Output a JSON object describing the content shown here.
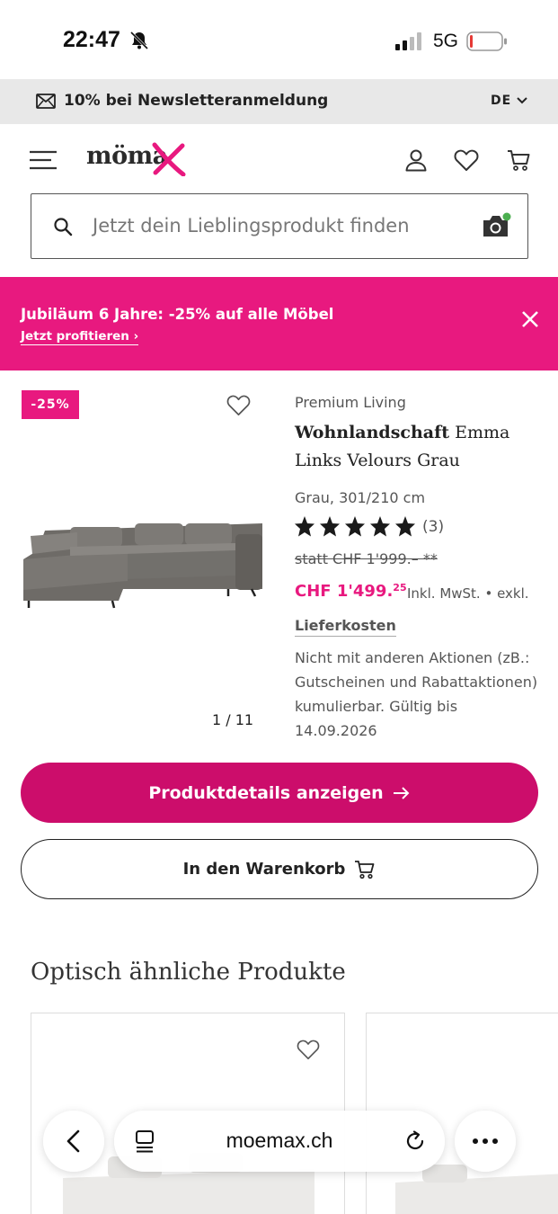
{
  "status_bar": {
    "time": "22:47",
    "network": "5G"
  },
  "newsletter": {
    "text": "10% bei Newsletteranmeldung",
    "language": "DE"
  },
  "header": {
    "logo_text": "möma"
  },
  "search": {
    "placeholder": "Jetzt dein Lieblingsprodukt finden"
  },
  "promo": {
    "title": "Jubiläum 6 Jahre: -25% auf alle Möbel",
    "link": "Jetzt profitieren ›",
    "color": "#e8197f"
  },
  "product": {
    "badge": "-25%",
    "image_counter": "1 / 11",
    "brand": "Premium Living",
    "title_bold": "Wohnlandschaft",
    "title_rest": " Emma Links Velours Grau",
    "variant": "Grau, 301/210 cm",
    "rating": 5,
    "reviews": "(3)",
    "old_price": "statt CHF 1'999.– **",
    "price_main": "CHF 1'499.",
    "price_cents": "25",
    "tax": "Inkl. MwSt. • exkl.",
    "delivery": "Lieferkosten",
    "note": "Nicht mit anderen Aktionen (zB.: Gutscheinen und Rabattaktionen) kumulierbar. Gültig bis 14.09.2026"
  },
  "buttons": {
    "details": "Produktdetails anzeigen",
    "cart": "In den Warenkorb"
  },
  "similar": {
    "title": "Optisch ähnliche Produkte"
  },
  "browser": {
    "url": "moemax.ch"
  },
  "colors": {
    "accent": "#e8197f",
    "button": "#cc0d6b"
  }
}
